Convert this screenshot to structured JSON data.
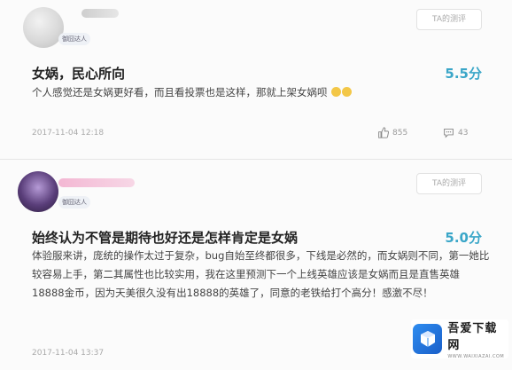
{
  "reviews": [
    {
      "user_name": "",
      "level_badge": "御囧达人",
      "follow_label": "TA的测评",
      "title": "女娲，民心所向",
      "score": "5.5分",
      "body": "个人感觉还是女娲更好看，而且看投票也是这样，那就上架女娲呗",
      "date": "2017-11-04 12:18",
      "likes": "855",
      "comments": "43"
    },
    {
      "user_name": "",
      "level_badge": "御囧达人",
      "follow_label": "TA的测评",
      "title": "始终认为不管是期待也好还是怎样肯定是女娲",
      "score": "5.0分",
      "body": "体验服来讲，庞统的操作太过于复杂，bug自始至终都很多，下线是必然的，而女娲则不同，第一她比较容易上手，第二其属性也比较实用，我在这里预测下一个上线英雄应该是女娲而且是直售英雄18888金币，因为天美很久没有出18888的英雄了，同意的老铁给打个高分！感激不尽！",
      "date": "2017-11-04 13:37"
    }
  ],
  "watermark": {
    "name": "吾爱下载网",
    "url": "WWW.WAIXIAZAI.COM"
  },
  "colors": {
    "score": "#3aa6c8",
    "badge_bg": "#eef1f6"
  },
  "icons": {
    "like": "thumbs-up-icon",
    "comment": "comment-icon",
    "emoji": "emoji-icon"
  }
}
